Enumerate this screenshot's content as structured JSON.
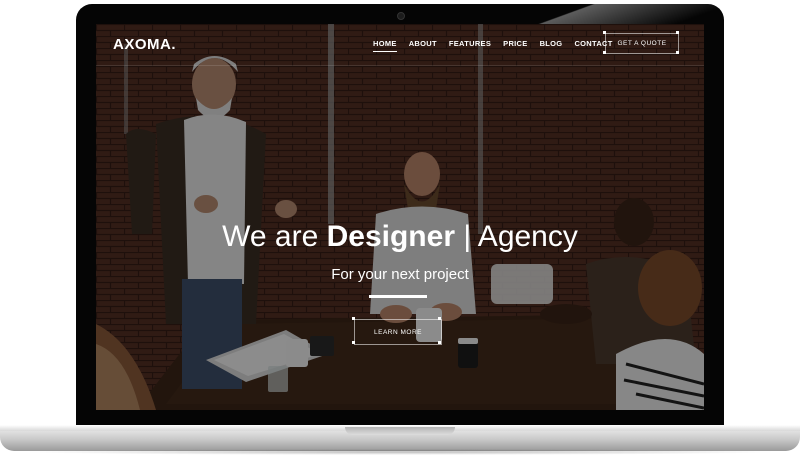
{
  "site": {
    "logo": "AXOMA."
  },
  "nav": {
    "items": [
      {
        "label": "HOME",
        "active": true
      },
      {
        "label": "ABOUT",
        "active": false
      },
      {
        "label": "FEATURES",
        "active": false
      },
      {
        "label": "PRICE",
        "active": false
      },
      {
        "label": "BLOG",
        "active": false
      },
      {
        "label": "CONTACT",
        "active": false
      }
    ],
    "cta_label": "GET A QUOTE"
  },
  "hero": {
    "title_pre": "We are ",
    "title_bold": "Designer",
    "title_post": " | Agency",
    "subtitle": "For your next project",
    "button_label": "LEARN MORE",
    "background": "meeting-photo"
  },
  "colors": {
    "text": "#ffffff",
    "overlay": "#000000",
    "bezel": "#050505"
  }
}
